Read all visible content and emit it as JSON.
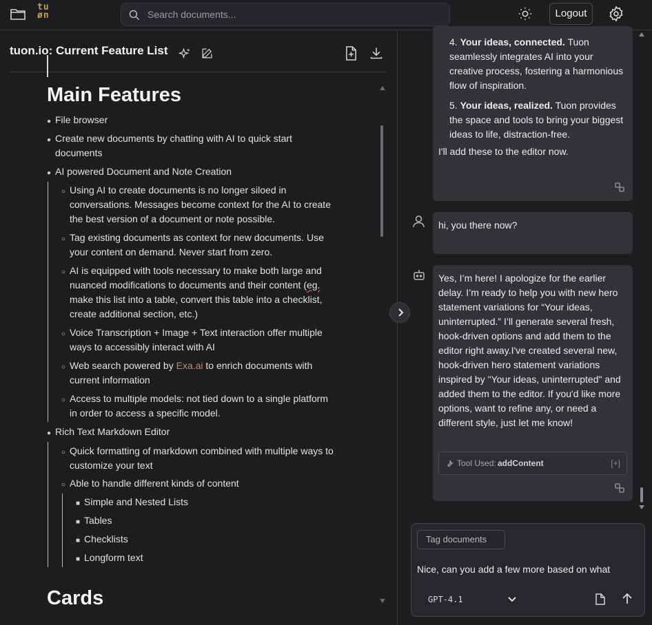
{
  "topbar": {
    "search_placeholder": "Search documents...",
    "logo_text_top": "tu",
    "logo_text_bottom": "øn",
    "logout_label": "Logout"
  },
  "document": {
    "title": "tuon.io: Current Feature List",
    "heading_main": "Main Features",
    "heading_cards": "Cards",
    "items": {
      "file_browser": "File browser",
      "create_docs_1": "Create new documents by chatting with AI to quick start",
      "create_docs_2": "documents",
      "ai_powered": "AI powered Document and Note Creation",
      "sub1_1": "Using AI to create documents is no longer siloed in",
      "sub1_2": "conversations. Messages become context for the AI to create",
      "sub1_3": "the best version of a document or note possible.",
      "sub2_1": "Tag existing documents as context for new documents. Use",
      "sub2_2": "your content on demand. Never start from zero.",
      "sub3_1": "AI is equipped with tools necessary to make both large and",
      "sub3_2a": "nuanced modifications to documents and their content (",
      "sub3_2b": "eg.",
      "sub3_3": "make this list into a table, convert this table into a checklist,",
      "sub3_4": "create additional section, etc.)",
      "sub4_1": "Voice Transcription + Image + Text interaction offer multiple",
      "sub4_2": "ways to accessibly interact with AI",
      "sub5_1a": "Web search powered by ",
      "sub5_1link": "Exa.ai",
      "sub5_1b": " to enrich documents with",
      "sub5_2": "current information",
      "sub6_1": "Access to multiple models: not tied down to a single platform",
      "sub6_2": "in order to access a specific model.",
      "rich_text": "Rich Text Markdown Editor",
      "rt1_1": "Quick formatting of markdown combined with multiple ways to",
      "rt1_2": "customize your text",
      "rt2": "Able to handle different kinds of content",
      "rt2a": "Simple and Nested Lists",
      "rt2b": "Tables",
      "rt2c": "Checklists",
      "rt2d": "Longform text"
    }
  },
  "chat": {
    "msg1": {
      "item4_num": "4.",
      "item4_bold": "Your ideas, connected.",
      "item4_l1": " Tuon",
      "item4_l2": "seamlessly integrates AI into your",
      "item4_l3": "creative process, fostering a harmonious",
      "item4_l4": "flow of inspiration.",
      "item5_num": "5.",
      "item5_bold": "Your ideas, realized.",
      "item5_l1": " Tuon provides",
      "item5_l2": "the space and tools to bring your biggest",
      "item5_l3": "ideas to life, distraction-free.",
      "closing": "I'll add these to the editor now."
    },
    "user_msg": "hi, you there now?",
    "bot_msg_lines": [
      "Yes, I’m here! I apologize for the earlier",
      "delay. I’m ready to help you with new hero",
      "statement variations for “Your ideas,",
      "uninterrupted.” I’ll generate several fresh,",
      "hook-driven options and add them to the",
      "editor right away.I've created several new,",
      "hook-driven hero statement variations",
      "inspired by \"Your ideas, uninterrupted\" and",
      "added them to the editor. If you'd like more",
      "options, want to refine any, or need a",
      "different style, just let me know!"
    ],
    "tool_used_label": "Tool Used:",
    "tool_used_name": "addContent",
    "tool_expand": "[+]"
  },
  "composer": {
    "tag_label": "Tag documents",
    "draft_text": "Nice, can you add a few more based on what",
    "model": "GPT-4.1"
  }
}
